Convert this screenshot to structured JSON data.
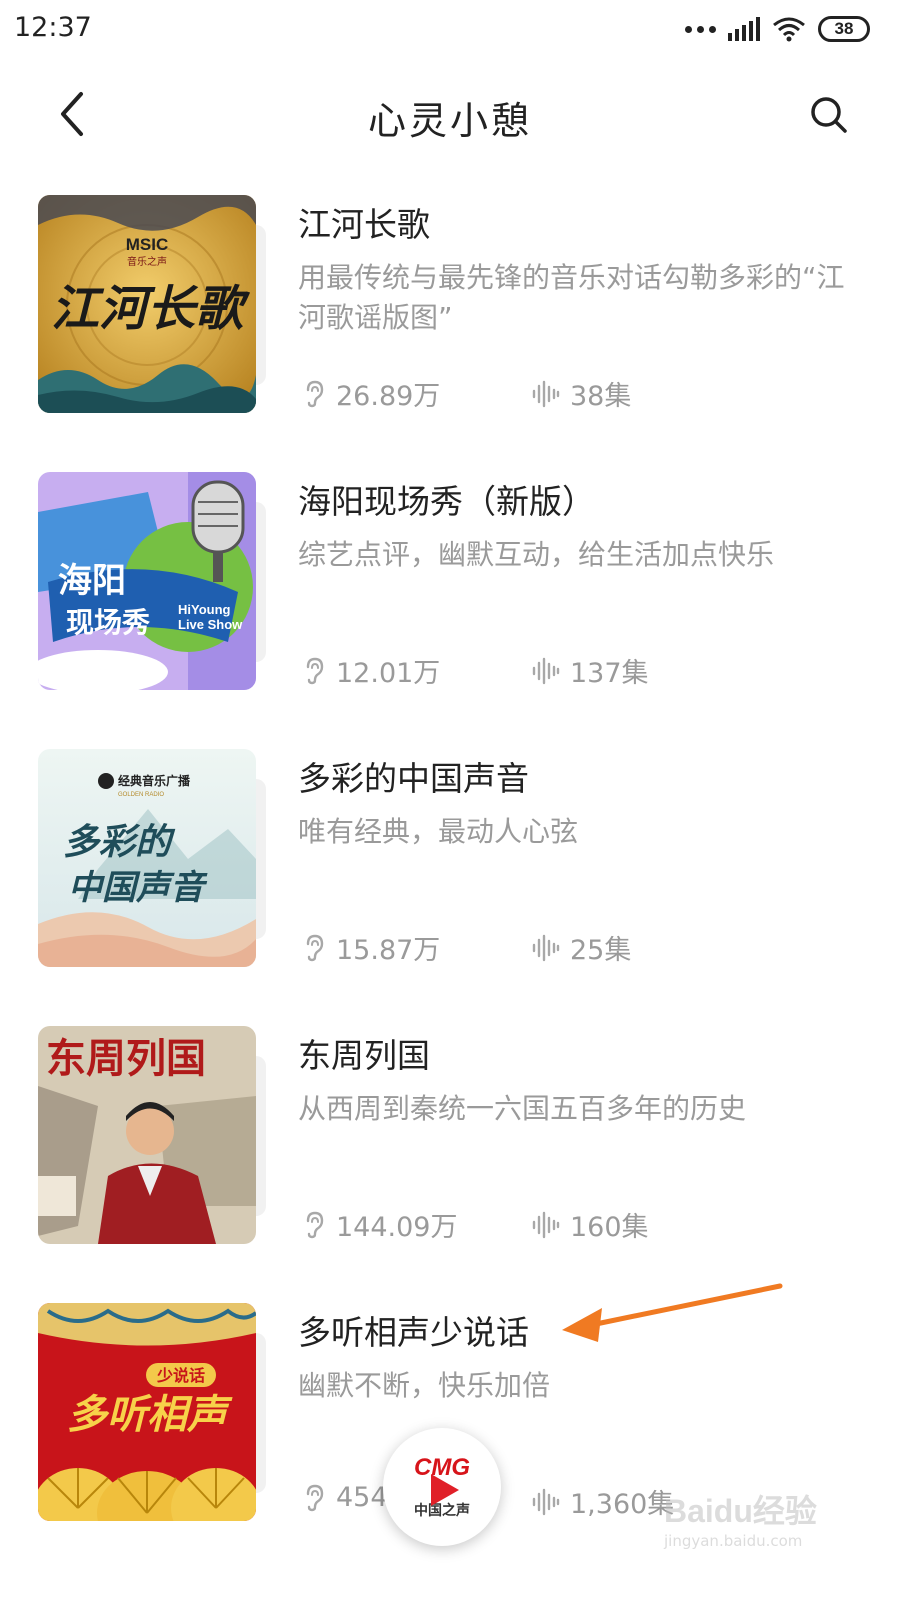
{
  "status_bar": {
    "time": "12:37",
    "battery": "38"
  },
  "header": {
    "title": "心灵小憩"
  },
  "items": [
    {
      "title": "江河长歌",
      "description": "用最传统与最先锋的音乐对话勾勒多彩的“江河歌谣版图”",
      "plays": "26.89万",
      "episodes": "38集",
      "cover": {
        "logo_main": "MSIC",
        "logo_sub": "音乐之声",
        "calligraphy": "江河长歌",
        "colors": [
          "#c9982f",
          "#2d6a6a"
        ]
      }
    },
    {
      "title": "海阳现场秀（新版）",
      "description": "综艺点评，幽默互动，给生活加点快乐",
      "plays": "12.01万",
      "episodes": "137集",
      "cover": {
        "calligraphy": "海阳\n现场秀",
        "en_line1": "HiYoung",
        "en_line2": "Live Show",
        "colors": [
          "#2d7bc8",
          "#b59be8"
        ]
      }
    },
    {
      "title": "多彩的中国声音",
      "description": "唯有经典，最动人心弦",
      "plays": "15.87万",
      "episodes": "25集",
      "cover": {
        "logo_main": "经典音乐广播",
        "logo_sub": "GOLDEN RADIO",
        "calligraphy_1": "多彩的",
        "calligraphy_2": "中国声音",
        "colors": [
          "#e8f2f2",
          "#1f4d5a"
        ]
      }
    },
    {
      "title": "东周列国",
      "description": "从西周到秦统一六国五百多年的历史",
      "plays": "144.09万",
      "episodes": "160集",
      "cover": {
        "calligraphy": "东周列国",
        "colors": [
          "#d8cdb7",
          "#8c1c1c"
        ]
      }
    },
    {
      "title": "多听相声少说话",
      "description": "幽默不断，快乐加倍",
      "plays": "454",
      "episodes": "1,360集",
      "cover": {
        "tag": "少说话",
        "calligraphy": "多听相声",
        "colors": [
          "#c8141a",
          "#f3c94a"
        ]
      }
    }
  ],
  "player": {
    "logo": "CMG",
    "sub": "中国之声"
  },
  "watermark": {
    "main": "Baidu经验",
    "url": "jingyan.baidu.com"
  },
  "icons": {
    "back": "chevron-left-icon",
    "search": "search-icon",
    "plays": "ear-icon",
    "episodes": "soundwave-icon"
  }
}
